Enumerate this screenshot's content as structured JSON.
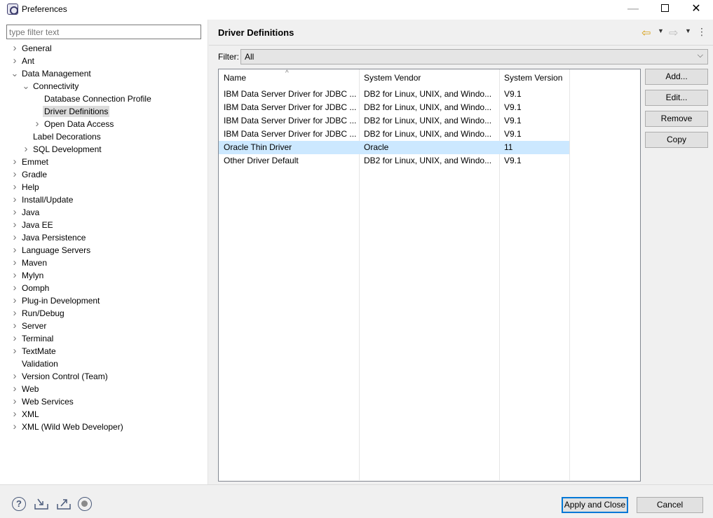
{
  "window": {
    "title": "Preferences",
    "minimize": "—",
    "close": "✕"
  },
  "filter": {
    "placeholder": "type filter text",
    "value": ""
  },
  "tree": [
    {
      "label": "General",
      "indent": 0,
      "expander": "closed"
    },
    {
      "label": "Ant",
      "indent": 0,
      "expander": "closed"
    },
    {
      "label": "Data Management",
      "indent": 0,
      "expander": "open"
    },
    {
      "label": "Connectivity",
      "indent": 1,
      "expander": "open"
    },
    {
      "label": "Database Connection Profile",
      "indent": 2,
      "expander": "none"
    },
    {
      "label": "Driver Definitions",
      "indent": 2,
      "expander": "none",
      "selected": true
    },
    {
      "label": "Open Data Access",
      "indent": 2,
      "expander": "closed"
    },
    {
      "label": "Label Decorations",
      "indent": 1,
      "expander": "none"
    },
    {
      "label": "SQL Development",
      "indent": 1,
      "expander": "closed"
    },
    {
      "label": "Emmet",
      "indent": 0,
      "expander": "closed"
    },
    {
      "label": "Gradle",
      "indent": 0,
      "expander": "closed"
    },
    {
      "label": "Help",
      "indent": 0,
      "expander": "closed"
    },
    {
      "label": "Install/Update",
      "indent": 0,
      "expander": "closed"
    },
    {
      "label": "Java",
      "indent": 0,
      "expander": "closed"
    },
    {
      "label": "Java EE",
      "indent": 0,
      "expander": "closed"
    },
    {
      "label": "Java Persistence",
      "indent": 0,
      "expander": "closed"
    },
    {
      "label": "Language Servers",
      "indent": 0,
      "expander": "closed"
    },
    {
      "label": "Maven",
      "indent": 0,
      "expander": "closed"
    },
    {
      "label": "Mylyn",
      "indent": 0,
      "expander": "closed"
    },
    {
      "label": "Oomph",
      "indent": 0,
      "expander": "closed"
    },
    {
      "label": "Plug-in Development",
      "indent": 0,
      "expander": "closed"
    },
    {
      "label": "Run/Debug",
      "indent": 0,
      "expander": "closed"
    },
    {
      "label": "Server",
      "indent": 0,
      "expander": "closed"
    },
    {
      "label": "Terminal",
      "indent": 0,
      "expander": "closed"
    },
    {
      "label": "TextMate",
      "indent": 0,
      "expander": "closed"
    },
    {
      "label": "Validation",
      "indent": 0,
      "expander": "none"
    },
    {
      "label": "Version Control (Team)",
      "indent": 0,
      "expander": "closed"
    },
    {
      "label": "Web",
      "indent": 0,
      "expander": "closed"
    },
    {
      "label": "Web Services",
      "indent": 0,
      "expander": "closed"
    },
    {
      "label": "XML",
      "indent": 0,
      "expander": "closed"
    },
    {
      "label": "XML (Wild Web Developer)",
      "indent": 0,
      "expander": "closed"
    }
  ],
  "page": {
    "title": "Driver Definitions",
    "filter_label": "Filter:",
    "filter_value": "All",
    "columns": [
      "Name",
      "System Vendor",
      "System Version"
    ],
    "rows": [
      {
        "name": "IBM Data Server Driver for JDBC ...",
        "vendor": "DB2 for Linux, UNIX, and Windo...",
        "version": "V9.1"
      },
      {
        "name": "IBM Data Server Driver for JDBC ...",
        "vendor": "DB2 for Linux, UNIX, and Windo...",
        "version": "V9.1"
      },
      {
        "name": "IBM Data Server Driver for JDBC ...",
        "vendor": "DB2 for Linux, UNIX, and Windo...",
        "version": "V9.1"
      },
      {
        "name": "IBM Data Server Driver for JDBC ...",
        "vendor": "DB2 for Linux, UNIX, and Windo...",
        "version": "V9.1"
      },
      {
        "name": "Oracle Thin Driver",
        "vendor": "Oracle",
        "version": "11",
        "selected": true
      },
      {
        "name": "Other Driver Default",
        "vendor": "DB2 for Linux, UNIX, and Windo...",
        "version": "V9.1"
      }
    ],
    "buttons": {
      "add": "Add...",
      "edit": "Edit...",
      "remove": "Remove",
      "copy": "Copy"
    }
  },
  "footer": {
    "apply_close": "Apply and Close",
    "cancel": "Cancel",
    "help": "?"
  },
  "icons": {
    "back": "arrow-left-icon",
    "forward": "arrow-right-icon",
    "menu": "view-menu-icon",
    "help": "help-icon",
    "import": "import-icon",
    "export": "export-icon",
    "record": "oomph-record-icon"
  },
  "colors": {
    "accent": "#0078d7",
    "selection": "#cce8ff",
    "tree_selection": "#dcdcdc",
    "back_arrow": "#d8a21b"
  }
}
